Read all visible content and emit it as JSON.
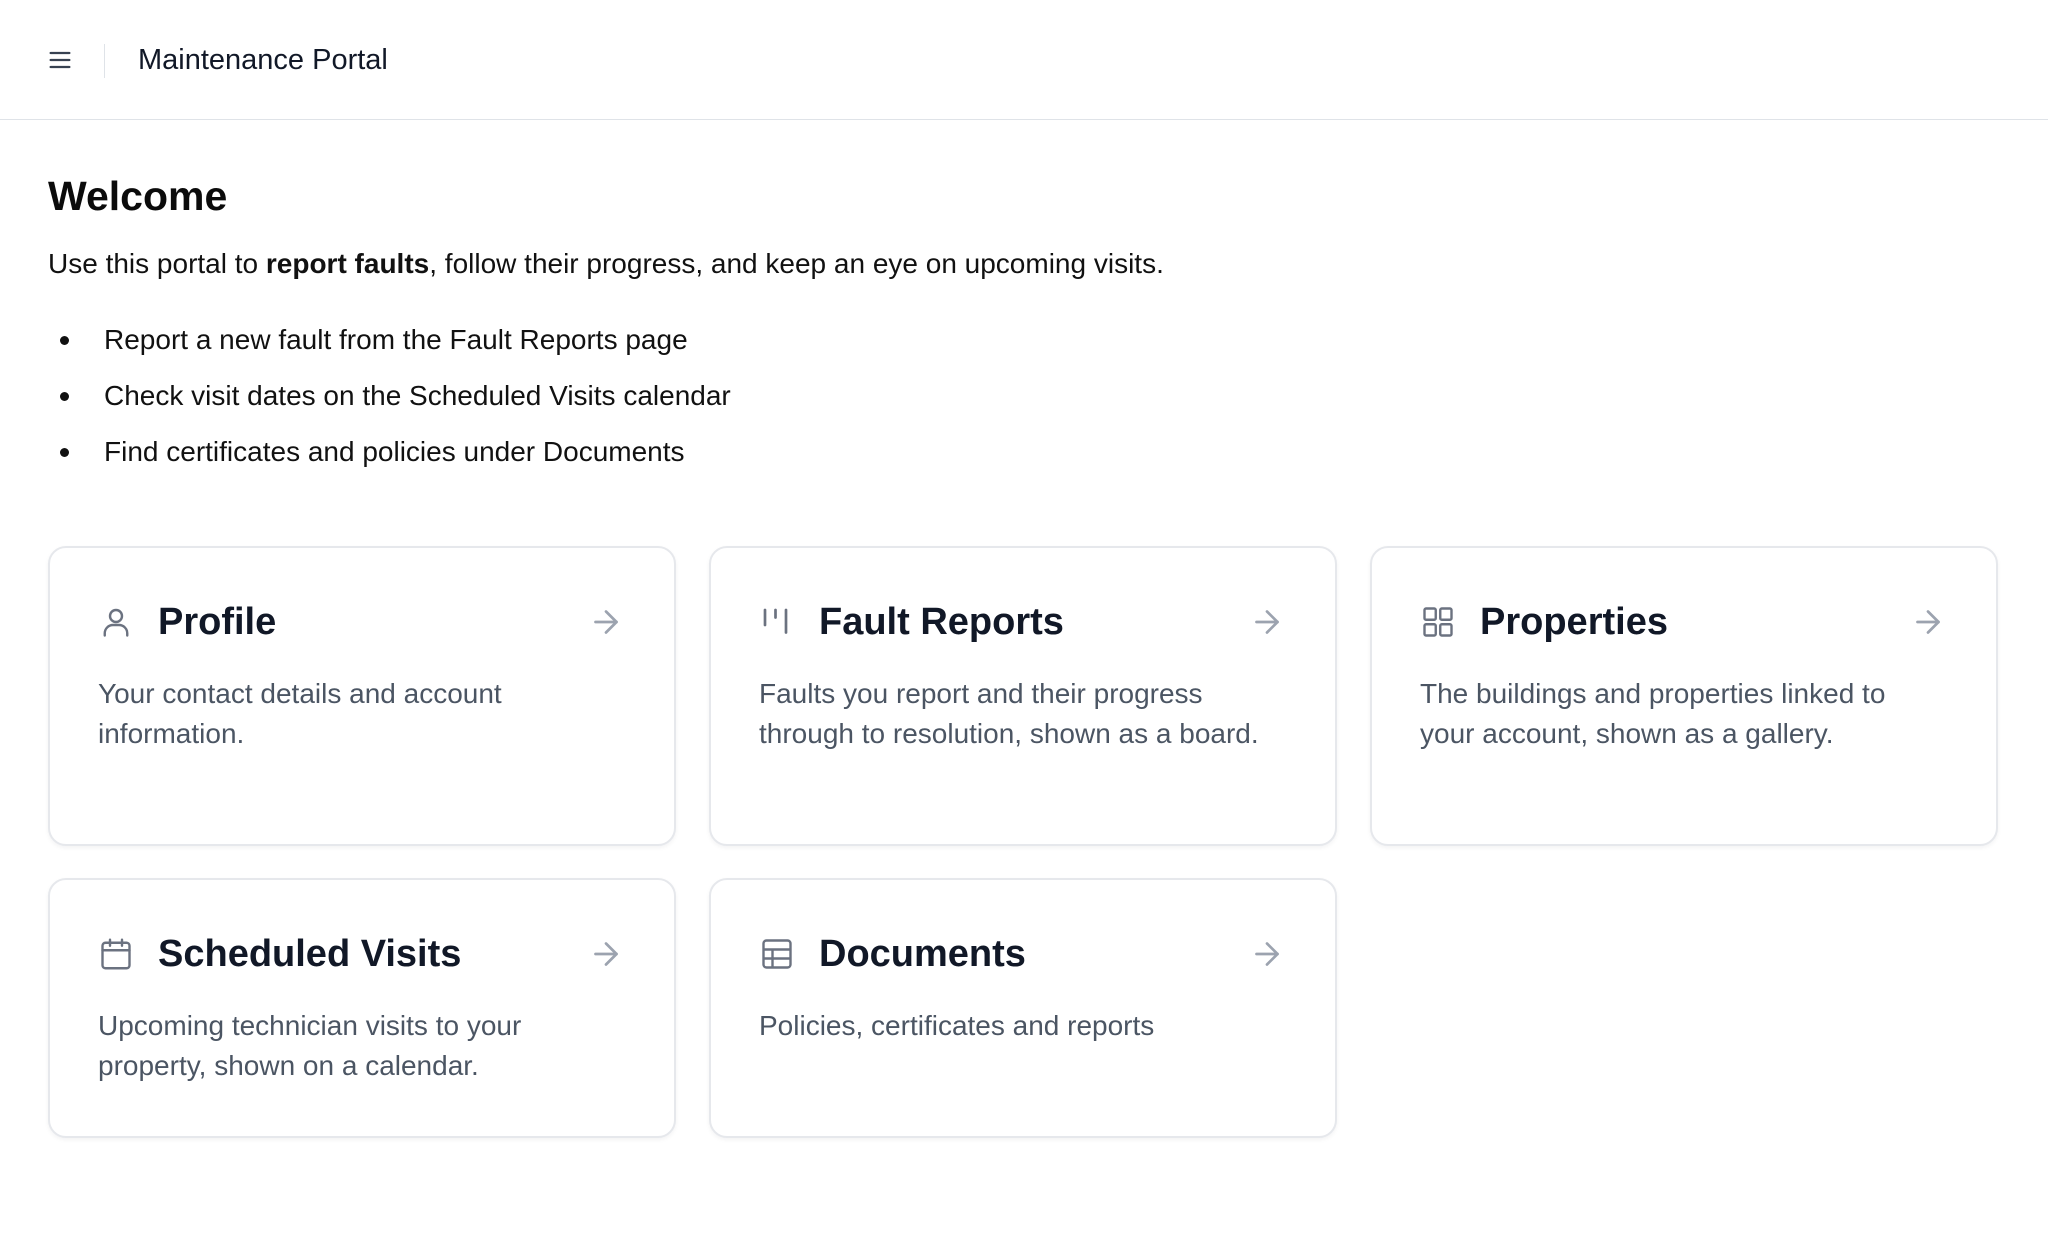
{
  "header": {
    "menu_icon": "hamburger-menu-icon",
    "app_title": "Maintenance Portal"
  },
  "main": {
    "title": "Welcome",
    "intro": {
      "before": "Use this portal to ",
      "emphasis": "report faults",
      "after": ", follow their progress, and keep an eye on upcoming visits."
    },
    "bullets": [
      "Report a new fault from the Fault Reports page",
      "Check visit dates on the Scheduled Visits calendar",
      "Find certificates and policies under Documents"
    ],
    "cards": [
      {
        "title": "Profile",
        "description": "Your contact details and account information.",
        "icon": "user-icon"
      },
      {
        "title": "Fault Reports",
        "description": "Faults you report and their progress through to resolution, shown as a board.",
        "icon": "kanban-columns-icon"
      },
      {
        "title": "Properties",
        "description": "The buildings and properties linked to your account, shown as a gallery.",
        "icon": "grid-icon"
      },
      {
        "title": "Scheduled Visits",
        "description": "Upcoming technician visits to your property, shown on a calendar.",
        "icon": "calendar-icon"
      },
      {
        "title": "Documents",
        "description": "Policies, certificates and reports",
        "icon": "table-icon"
      }
    ],
    "arrow_icon": "arrow-right-icon"
  },
  "colors": {
    "text_primary": "#111827",
    "text_secondary": "#4b5563",
    "icon": "#6b7280",
    "border": "#e6e8ec"
  }
}
